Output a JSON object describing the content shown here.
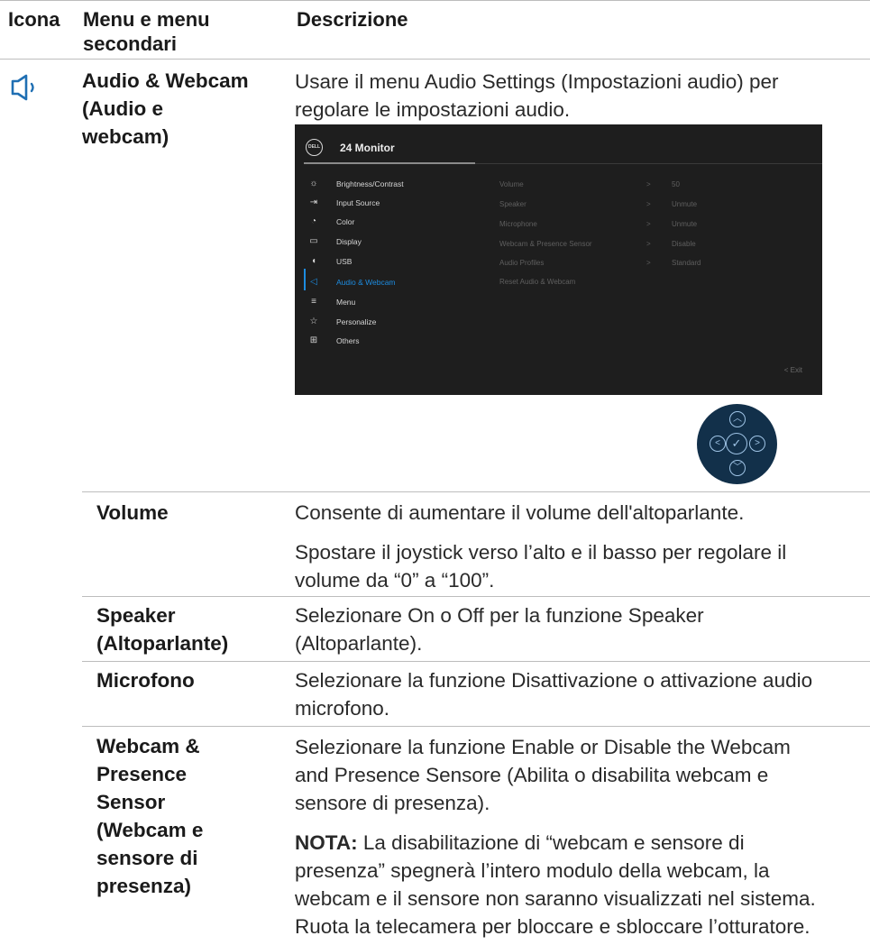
{
  "header": {
    "col_icon": "Icona",
    "col_menu_l1": "Menu e menu",
    "col_menu_l2": "secondari",
    "col_desc": "Descrizione"
  },
  "main_row": {
    "icon": "speaker-icon",
    "menu_l1": "Audio & Webcam",
    "menu_l2": "(Audio e",
    "menu_l3": "webcam)",
    "desc_l1": "Usare il menu Audio Settings (Impostazioni audio) per",
    "desc_l2": "regolare le impostazioni audio."
  },
  "osd": {
    "title": "24 Monitor",
    "logo": "DELL",
    "menu_items": [
      {
        "icon": "brightness-icon",
        "glyph": "☼",
        "label": "Brightness/Contrast"
      },
      {
        "icon": "input-source-icon",
        "glyph": "⇥",
        "label": "Input Source"
      },
      {
        "icon": "color-icon",
        "glyph": "◔",
        "label": "Color"
      },
      {
        "icon": "display-icon",
        "glyph": "▭",
        "label": "Display"
      },
      {
        "icon": "usb-icon",
        "glyph": "◖",
        "label": "USB"
      },
      {
        "icon": "audio-icon",
        "glyph": "◁",
        "label": "Audio & Webcam"
      },
      {
        "icon": "menu-icon",
        "glyph": "≡",
        "label": "Menu"
      },
      {
        "icon": "personalize-icon",
        "glyph": "☆",
        "label": "Personalize"
      },
      {
        "icon": "others-icon",
        "glyph": "⊞",
        "label": "Others"
      }
    ],
    "active_index": 5,
    "submenu": [
      {
        "label": "Volume",
        "arrow": ">",
        "value": "50"
      },
      {
        "label": "Speaker",
        "arrow": ">",
        "value": "Unmute"
      },
      {
        "label": "Microphone",
        "arrow": ">",
        "value": "Unmute"
      },
      {
        "label": "Webcam & Presence Sensor",
        "arrow": ">",
        "value": "Disable"
      },
      {
        "label": "Audio Profiles",
        "arrow": ">",
        "value": "Standard"
      },
      {
        "label": "Reset Audio & Webcam",
        "arrow": "",
        "value": ""
      }
    ],
    "exit_label": "<  Exit"
  },
  "joystick": {
    "up": "︿",
    "down": "﹀",
    "left": "<",
    "right": ">",
    "center": "✓"
  },
  "rows": {
    "volume": {
      "name": "Volume",
      "desc1": "Consente di aumentare il volume dell'altoparlante.",
      "desc2_l1": "Spostare il joystick verso l’alto e il basso per regolare il",
      "desc2_l2": "volume da “0” a “100”."
    },
    "speaker": {
      "name_l1": "Speaker",
      "name_l2": "(Altoparlante)",
      "desc_l1": "Selezionare On o Off per la funzione Speaker",
      "desc_l2": "(Altoparlante)."
    },
    "mic": {
      "name": "Microfono",
      "desc_l1": "Selezionare la funzione Disattivazione o attivazione audio",
      "desc_l2": "microfono."
    },
    "webcam": {
      "name_lines": [
        "Webcam &",
        "Presence",
        "Sensor",
        "(Webcam e",
        "sensore di",
        "presenza)"
      ],
      "desc_l1": "Selezionare la funzione Enable or Disable the Webcam",
      "desc_l2": "and Presence Sensore (Abilita o disabilita webcam e",
      "desc_l3": "sensore di presenza).",
      "note_label": "NOTA:",
      "note_l1": " La disabilitazione di “webcam e sensore di",
      "note_l2": "presenza” spegnerà l’intero modulo della webcam, la",
      "note_l3": "webcam e il sensore non saranno visualizzati nel sistema.",
      "last": "Ruota la telecamera per bloccare e sbloccare l’otturatore."
    }
  }
}
